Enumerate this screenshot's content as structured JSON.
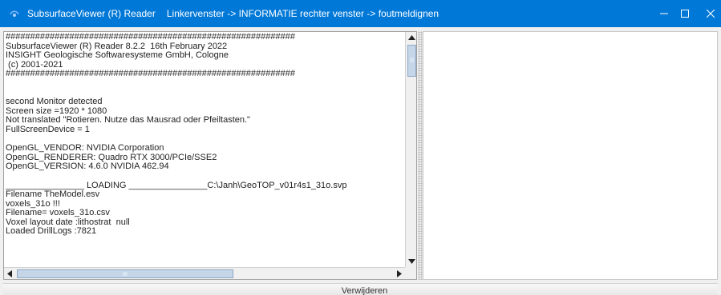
{
  "window": {
    "app_name": "SubsurfaceViewer (R) Reader",
    "subtitle": "Linkervenster -> INFORMATIE  rechter venster -> foutmeldignen",
    "minimize_glyph": "—",
    "maximize_glyph": "☐",
    "close_glyph": "✕"
  },
  "log": {
    "lines": [
      "###########################################################",
      "SubsurfaceViewer (R) Reader 8.2.2  16th February 2022",
      "INSIGHT Geologische Softwaresysteme GmbH, Cologne",
      " (c) 2001-2021",
      "###########################################################",
      "",
      "",
      "second Monitor detected",
      "Screen size =1920 * 1080",
      "Not translated \"Rotieren. Nutze das Mausrad oder Pfeiltasten.\"",
      "FullScreenDevice = 1",
      "",
      "OpenGL_VENDOR: NVIDIA Corporation",
      "OpenGL_RENDERER: Quadro RTX 3000/PCIe/SSE2",
      "OpenGL_VERSION: 4.6.0 NVIDIA 462.94",
      "",
      "________________ LOADING ________________C:\\Janh\\GeoTOP_v01r4s1_31o.svp",
      "Filename TheModel.esv",
      "voxels_31o !!!",
      "Filename= voxels_31o.csv",
      "Voxel layout date :lithostrat  null",
      "Loaded DrillLogs :7821"
    ]
  },
  "scrollbar": {
    "up_glyph": "▲",
    "down_glyph": "▼",
    "left_glyph": "◀",
    "right_glyph": "▶"
  },
  "bottom_button": {
    "label": "Verwijderen"
  },
  "colors": {
    "titlebar": "#0078d7",
    "scroll_thumb": "#c4d6e8"
  }
}
